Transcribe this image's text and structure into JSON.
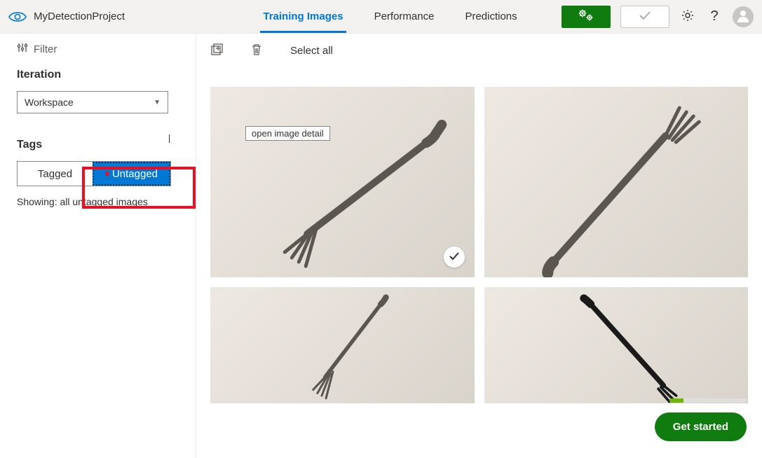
{
  "header": {
    "project_name": "MyDetectionProject",
    "tabs": {
      "training_images": "Training Images",
      "performance": "Performance",
      "predictions": "Predictions"
    }
  },
  "sidebar": {
    "filter_label": "Filter",
    "iteration_label": "Iteration",
    "iteration_value": "Workspace",
    "tags_label": "Tags",
    "tagged_label": "Tagged",
    "untagged_label": "Untagged",
    "showing_text": "Showing: all untagged images"
  },
  "toolbar": {
    "select_all": "Select all"
  },
  "tooltip": {
    "open_detail": "open image detail"
  },
  "footer": {
    "get_started": "Get started"
  },
  "colors": {
    "accent": "#0078d4",
    "green": "#107c10",
    "red": "#e81123"
  }
}
